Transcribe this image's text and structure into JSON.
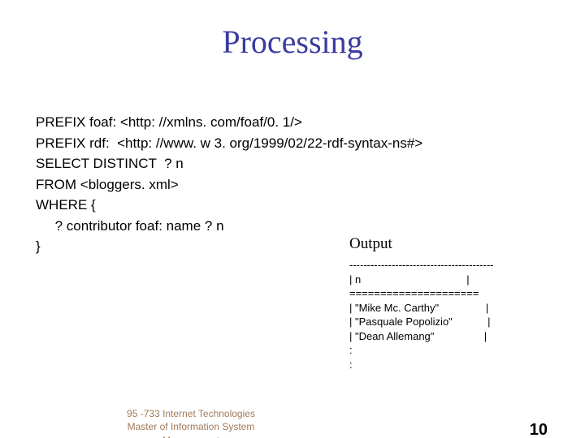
{
  "title": "Processing",
  "code": "PREFIX foaf: <http: //xmlns. com/foaf/0. 1/>\nPREFIX rdf:  <http: //www. w 3. org/1999/02/22-rdf-syntax-ns#>\nSELECT DISTINCT  ? n\nFROM <bloggers. xml>\nWHERE {\n     ? contributor foaf: name ? n\n}",
  "output_label": "Output",
  "output": "-----------------------------------------\n| n                                    |\n=====================\n| \"Mike Mc. Carthy\"                |\n| \"Pasquale Popolizio\"            |\n| \"Dean Allemang\"                 |\n:\n:",
  "footer_line1": "95 -733 Internet Technologies",
  "footer_line2": "Master of Information System Management",
  "page_number": "10"
}
